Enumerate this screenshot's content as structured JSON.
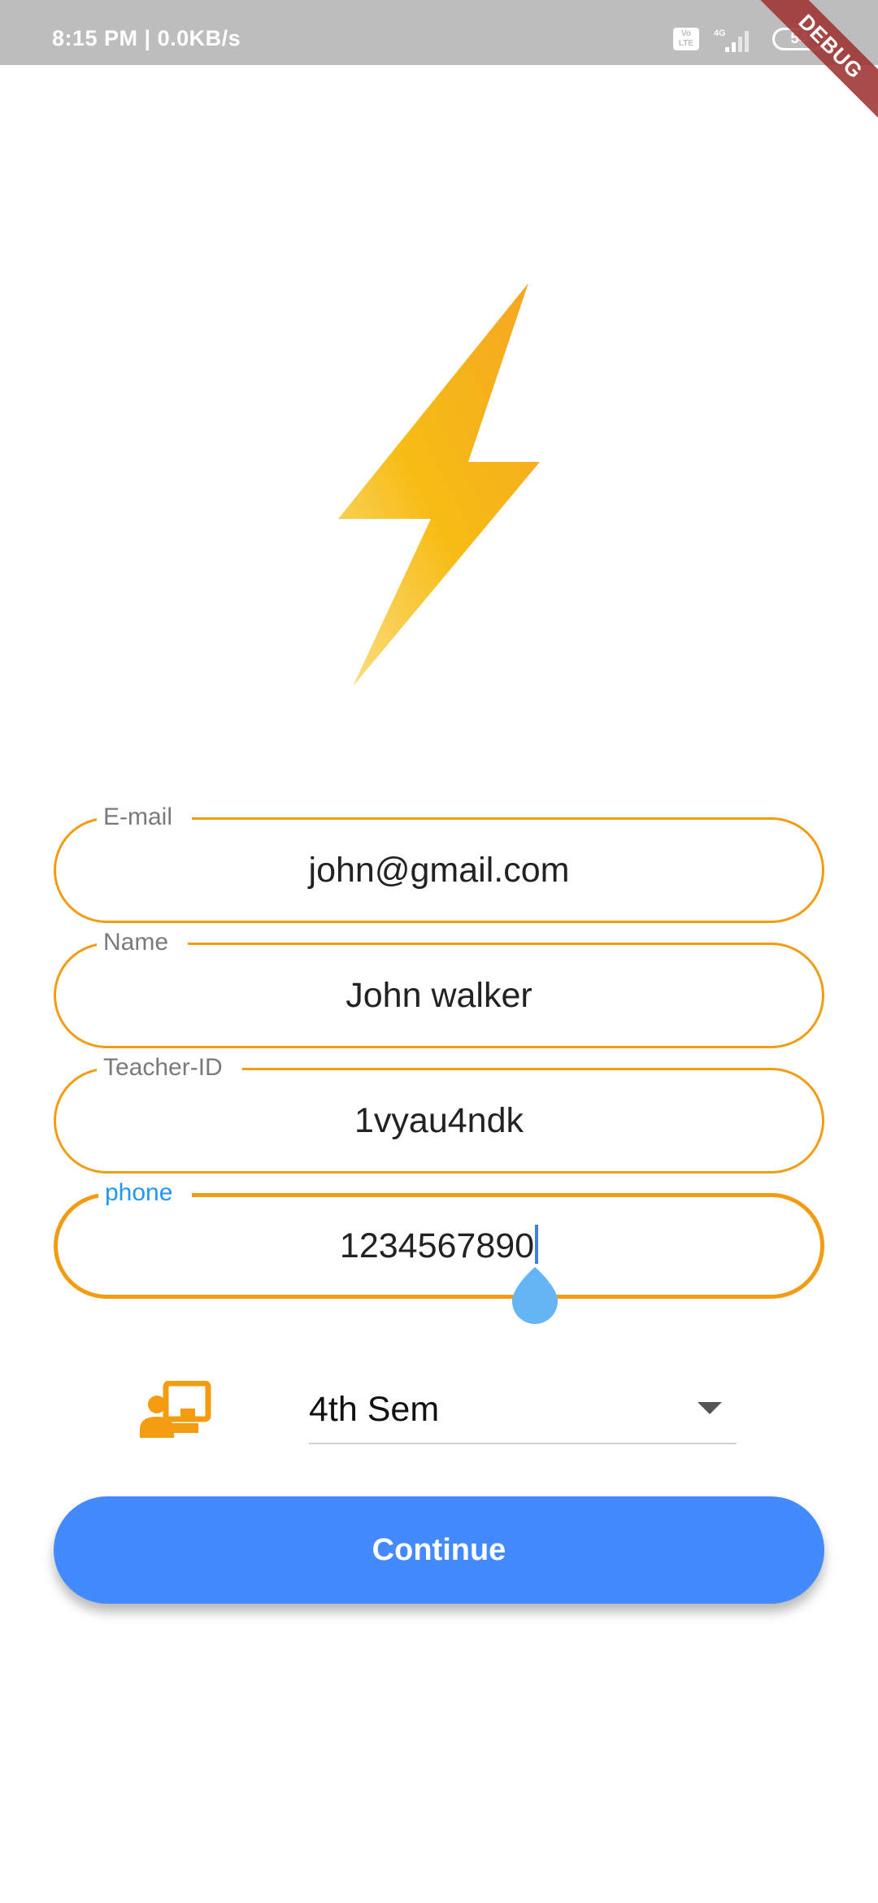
{
  "status_bar": {
    "time_speed": "8:15 PM | 0.0KB/s",
    "volte": "Vo LTE",
    "network": "4G",
    "battery": "54",
    "debug": "DEBUG"
  },
  "logo": {
    "icon": "lightning-bolt-icon",
    "colors": [
      "#f5a623",
      "#f9c515",
      "#fbe08a"
    ]
  },
  "form": {
    "email": {
      "label": "E-mail",
      "value": "john@gmail.com"
    },
    "name": {
      "label": "Name",
      "value": "John walker"
    },
    "teacher_id": {
      "label": "Teacher-ID",
      "value": "1vyau4ndk"
    },
    "phone": {
      "label": "phone",
      "value": "1234567890"
    }
  },
  "semester": {
    "icon": "teacher-presentation-icon",
    "selected": "4th Sem"
  },
  "continue_label": "Continue",
  "colors": {
    "field_border": "#f39c12",
    "focus_label": "#2196f3",
    "button": "#448aff",
    "icon": "#f39c12"
  }
}
